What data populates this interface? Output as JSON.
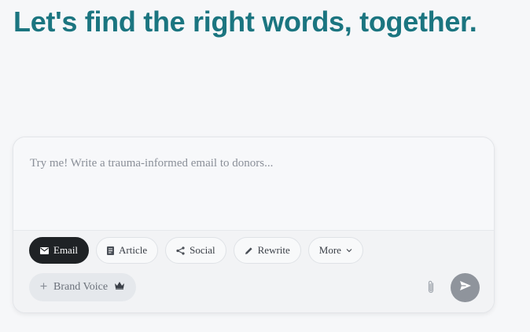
{
  "headline": "Let's find the right words, together.",
  "prompt": {
    "placeholder": "Try me! Write a trauma-informed email to donors...",
    "value": ""
  },
  "content_types": [
    {
      "label": "Email",
      "icon": "mail-icon",
      "active": true
    },
    {
      "label": "Article",
      "icon": "document-icon",
      "active": false
    },
    {
      "label": "Social",
      "icon": "share-icon",
      "active": false
    },
    {
      "label": "Rewrite",
      "icon": "pencil-icon",
      "active": false
    },
    {
      "label": "More",
      "icon": "chevron-down-icon",
      "active": false
    }
  ],
  "brand_voice": {
    "label": "Brand Voice",
    "prefix_icon": "plus-icon",
    "suffix_icon": "crown-icon"
  },
  "actions": {
    "attach_icon": "paperclip-icon",
    "send_icon": "send-icon"
  },
  "colors": {
    "headline": "#1b7580",
    "active_chip": "#1f2225",
    "send_button": "#8f949c"
  }
}
